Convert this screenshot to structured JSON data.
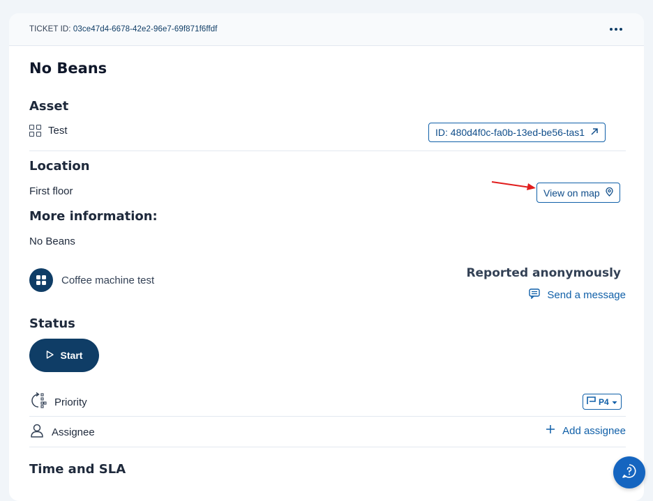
{
  "header": {
    "ticket_label": "TICKET ID:",
    "ticket_id": "03ce47d4-6678-42e2-96e7-69f871f6ffdf",
    "more_icon": "more-horizontal-icon"
  },
  "ticket": {
    "title": "No Beans"
  },
  "asset": {
    "heading": "Asset",
    "name": "Test",
    "icon": "grid-icon",
    "id_button_label": "ID: 480d4f0c-fa0b-13ed-be56-tas1",
    "id_button_icon": "external-link-arrow-icon"
  },
  "location": {
    "heading": "Location",
    "value": "First floor",
    "map_button_label": "View on map",
    "map_button_icon": "map-pin-icon"
  },
  "more_info": {
    "heading": "More information:",
    "value": "No Beans"
  },
  "reporter": {
    "name": "Coffee machine test",
    "anonymous_label": "Reported anonymously",
    "send_message_label": "Send a message",
    "send_message_icon": "message-icon"
  },
  "status": {
    "heading": "Status",
    "start_label": "Start"
  },
  "priority": {
    "label": "Priority",
    "value": "P4"
  },
  "assignee": {
    "label": "Assignee",
    "add_label": "Add assignee"
  },
  "time_sla": {
    "heading": "Time and SLA"
  },
  "colors": {
    "brand": "#0f3d66",
    "link": "#0f5fa8",
    "annotation_arrow": "#e11d1d",
    "help_button": "#1565c0"
  }
}
